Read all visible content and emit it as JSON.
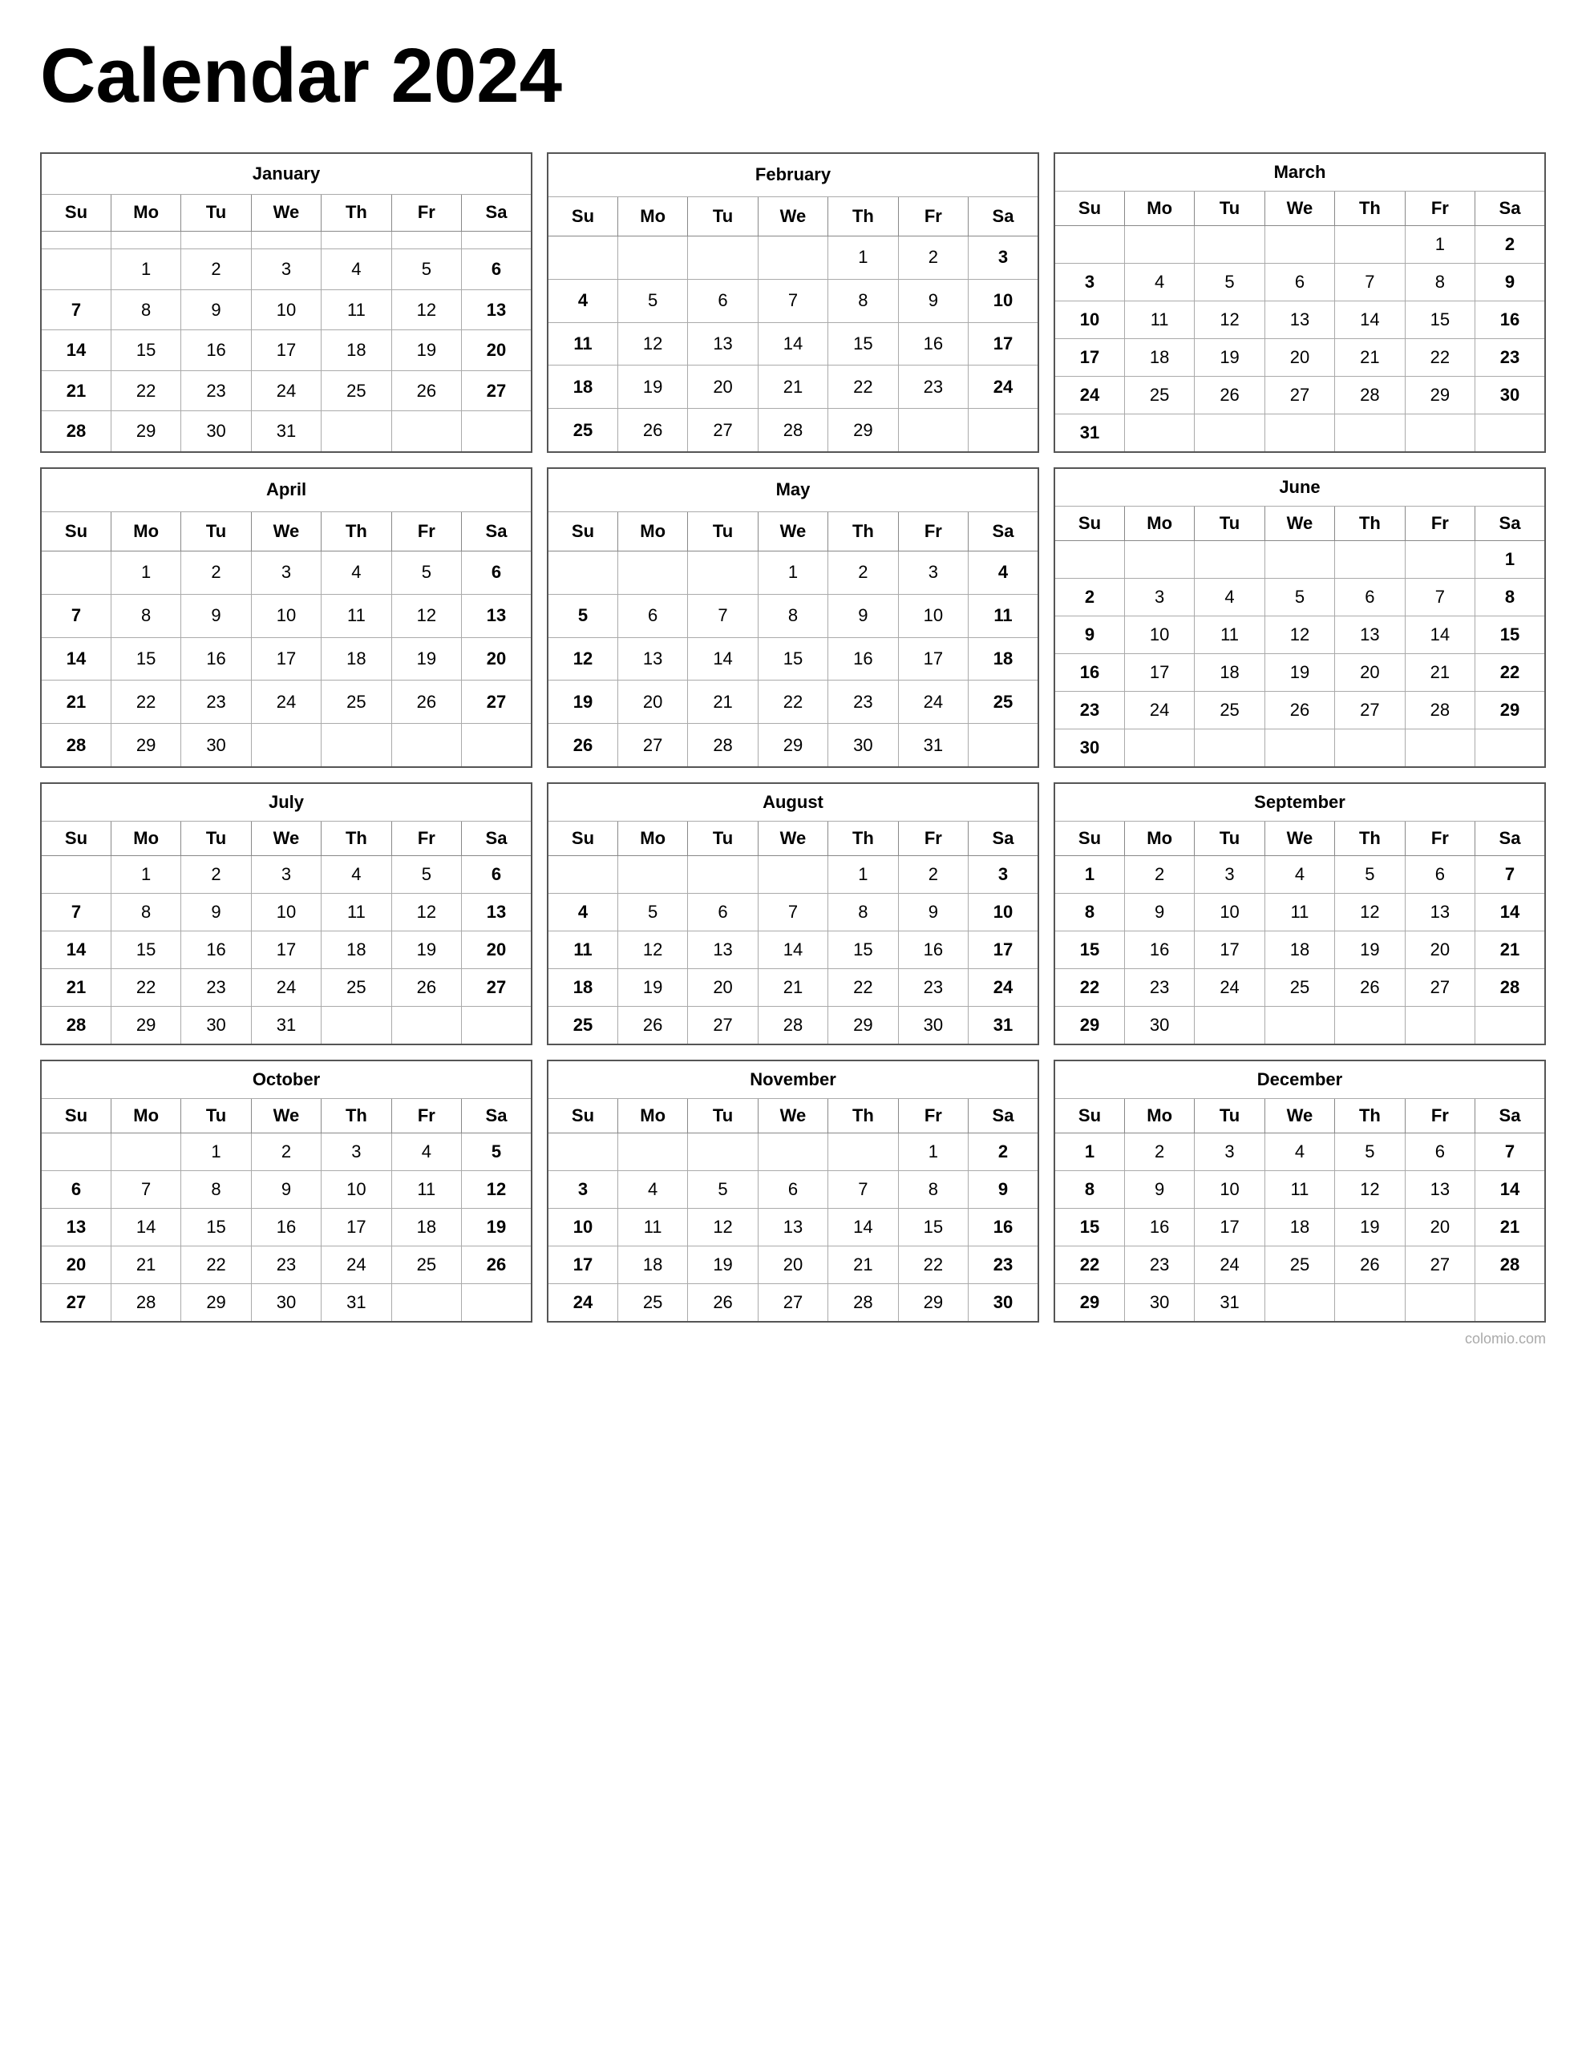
{
  "title": "Calendar 2024",
  "months": [
    {
      "name": "January",
      "days": [
        "Su",
        "Mo",
        "Tu",
        "We",
        "Th",
        "Fr",
        "Sa"
      ],
      "weeks": [
        [
          "",
          "",
          "",
          "",
          "",
          "",
          ""
        ],
        [
          "",
          "1",
          "2",
          "3",
          "4",
          "5",
          "6"
        ],
        [
          "7",
          "8",
          "9",
          "10",
          "11",
          "12",
          "13"
        ],
        [
          "14",
          "15",
          "16",
          "17",
          "18",
          "19",
          "20"
        ],
        [
          "21",
          "22",
          "23",
          "24",
          "25",
          "26",
          "27"
        ],
        [
          "28",
          "29",
          "30",
          "31",
          "",
          "",
          ""
        ]
      ],
      "bold_sunday_col": 0,
      "bold_saturday_col": 6
    },
    {
      "name": "February",
      "days": [
        "Su",
        "Mo",
        "Tu",
        "We",
        "Th",
        "Fr",
        "Sa"
      ],
      "weeks": [
        [
          "",
          "",
          "",
          "",
          "1",
          "2",
          "3"
        ],
        [
          "4",
          "5",
          "6",
          "7",
          "8",
          "9",
          "10"
        ],
        [
          "11",
          "12",
          "13",
          "14",
          "15",
          "16",
          "17"
        ],
        [
          "18",
          "19",
          "20",
          "21",
          "22",
          "23",
          "24"
        ],
        [
          "25",
          "26",
          "27",
          "28",
          "29",
          "",
          ""
        ]
      ]
    },
    {
      "name": "March",
      "days": [
        "Su",
        "Mo",
        "Tu",
        "We",
        "Th",
        "Fr",
        "Sa"
      ],
      "weeks": [
        [
          "",
          "",
          "",
          "",
          "",
          "1",
          "2"
        ],
        [
          "3",
          "4",
          "5",
          "6",
          "7",
          "8",
          "9"
        ],
        [
          "10",
          "11",
          "12",
          "13",
          "14",
          "15",
          "16"
        ],
        [
          "17",
          "18",
          "19",
          "20",
          "21",
          "22",
          "23"
        ],
        [
          "24",
          "25",
          "26",
          "27",
          "28",
          "29",
          "30"
        ],
        [
          "31",
          "",
          "",
          "",
          "",
          "",
          ""
        ]
      ]
    },
    {
      "name": "April",
      "days": [
        "Su",
        "Mo",
        "Tu",
        "We",
        "Th",
        "Fr",
        "Sa"
      ],
      "weeks": [
        [
          "",
          "1",
          "2",
          "3",
          "4",
          "5",
          "6"
        ],
        [
          "7",
          "8",
          "9",
          "10",
          "11",
          "12",
          "13"
        ],
        [
          "14",
          "15",
          "16",
          "17",
          "18",
          "19",
          "20"
        ],
        [
          "21",
          "22",
          "23",
          "24",
          "25",
          "26",
          "27"
        ],
        [
          "28",
          "29",
          "30",
          "",
          "",
          "",
          ""
        ]
      ]
    },
    {
      "name": "May",
      "days": [
        "Su",
        "Mo",
        "Tu",
        "We",
        "Th",
        "Fr",
        "Sa"
      ],
      "weeks": [
        [
          "",
          "",
          "",
          "1",
          "2",
          "3",
          "4"
        ],
        [
          "5",
          "6",
          "7",
          "8",
          "9",
          "10",
          "11"
        ],
        [
          "12",
          "13",
          "14",
          "15",
          "16",
          "17",
          "18"
        ],
        [
          "19",
          "20",
          "21",
          "22",
          "23",
          "24",
          "25"
        ],
        [
          "26",
          "27",
          "28",
          "29",
          "30",
          "31",
          ""
        ]
      ]
    },
    {
      "name": "June",
      "days": [
        "Su",
        "Mo",
        "Tu",
        "We",
        "Th",
        "Fr",
        "Sa"
      ],
      "weeks": [
        [
          "",
          "",
          "",
          "",
          "",
          "",
          "1"
        ],
        [
          "2",
          "3",
          "4",
          "5",
          "6",
          "7",
          "8"
        ],
        [
          "9",
          "10",
          "11",
          "12",
          "13",
          "14",
          "15"
        ],
        [
          "16",
          "17",
          "18",
          "19",
          "20",
          "21",
          "22"
        ],
        [
          "23",
          "24",
          "25",
          "26",
          "27",
          "28",
          "29"
        ],
        [
          "30",
          "",
          "",
          "",
          "",
          "",
          ""
        ]
      ]
    },
    {
      "name": "July",
      "days": [
        "Su",
        "Mo",
        "Tu",
        "We",
        "Th",
        "Fr",
        "Sa"
      ],
      "weeks": [
        [
          "",
          "1",
          "2",
          "3",
          "4",
          "5",
          "6"
        ],
        [
          "7",
          "8",
          "9",
          "10",
          "11",
          "12",
          "13"
        ],
        [
          "14",
          "15",
          "16",
          "17",
          "18",
          "19",
          "20"
        ],
        [
          "21",
          "22",
          "23",
          "24",
          "25",
          "26",
          "27"
        ],
        [
          "28",
          "29",
          "30",
          "31",
          "",
          "",
          ""
        ]
      ]
    },
    {
      "name": "August",
      "days": [
        "Su",
        "Mo",
        "Tu",
        "We",
        "Th",
        "Fr",
        "Sa"
      ],
      "weeks": [
        [
          "",
          "",
          "",
          "",
          "1",
          "2",
          "3"
        ],
        [
          "4",
          "5",
          "6",
          "7",
          "8",
          "9",
          "10"
        ],
        [
          "11",
          "12",
          "13",
          "14",
          "15",
          "16",
          "17"
        ],
        [
          "18",
          "19",
          "20",
          "21",
          "22",
          "23",
          "24"
        ],
        [
          "25",
          "26",
          "27",
          "28",
          "29",
          "30",
          "31"
        ]
      ]
    },
    {
      "name": "September",
      "days": [
        "Su",
        "Mo",
        "Tu",
        "We",
        "Th",
        "Fr",
        "Sa"
      ],
      "weeks": [
        [
          "1",
          "2",
          "3",
          "4",
          "5",
          "6",
          "7"
        ],
        [
          "8",
          "9",
          "10",
          "11",
          "12",
          "13",
          "14"
        ],
        [
          "15",
          "16",
          "17",
          "18",
          "19",
          "20",
          "21"
        ],
        [
          "22",
          "23",
          "24",
          "25",
          "26",
          "27",
          "28"
        ],
        [
          "29",
          "30",
          "",
          "",
          "",
          "",
          ""
        ]
      ]
    },
    {
      "name": "October",
      "days": [
        "Su",
        "Mo",
        "Tu",
        "We",
        "Th",
        "Fr",
        "Sa"
      ],
      "weeks": [
        [
          "",
          "",
          "1",
          "2",
          "3",
          "4",
          "5"
        ],
        [
          "6",
          "7",
          "8",
          "9",
          "10",
          "11",
          "12"
        ],
        [
          "13",
          "14",
          "15",
          "16",
          "17",
          "18",
          "19"
        ],
        [
          "20",
          "21",
          "22",
          "23",
          "24",
          "25",
          "26"
        ],
        [
          "27",
          "28",
          "29",
          "30",
          "31",
          "",
          ""
        ]
      ]
    },
    {
      "name": "November",
      "days": [
        "Su",
        "Mo",
        "Tu",
        "We",
        "Th",
        "Fr",
        "Sa"
      ],
      "weeks": [
        [
          "",
          "",
          "",
          "",
          "",
          "1",
          "2"
        ],
        [
          "3",
          "4",
          "5",
          "6",
          "7",
          "8",
          "9"
        ],
        [
          "10",
          "11",
          "12",
          "13",
          "14",
          "15",
          "16"
        ],
        [
          "17",
          "18",
          "19",
          "20",
          "21",
          "22",
          "23"
        ],
        [
          "24",
          "25",
          "26",
          "27",
          "28",
          "29",
          "30"
        ]
      ]
    },
    {
      "name": "December",
      "days": [
        "Su",
        "Mo",
        "Tu",
        "We",
        "Th",
        "Fr",
        "Sa"
      ],
      "weeks": [
        [
          "1",
          "2",
          "3",
          "4",
          "5",
          "6",
          "7"
        ],
        [
          "8",
          "9",
          "10",
          "11",
          "12",
          "13",
          "14"
        ],
        [
          "15",
          "16",
          "17",
          "18",
          "19",
          "20",
          "21"
        ],
        [
          "22",
          "23",
          "24",
          "25",
          "26",
          "27",
          "28"
        ],
        [
          "29",
          "30",
          "31",
          "",
          "",
          "",
          ""
        ]
      ]
    }
  ],
  "watermark": "colomio.com"
}
